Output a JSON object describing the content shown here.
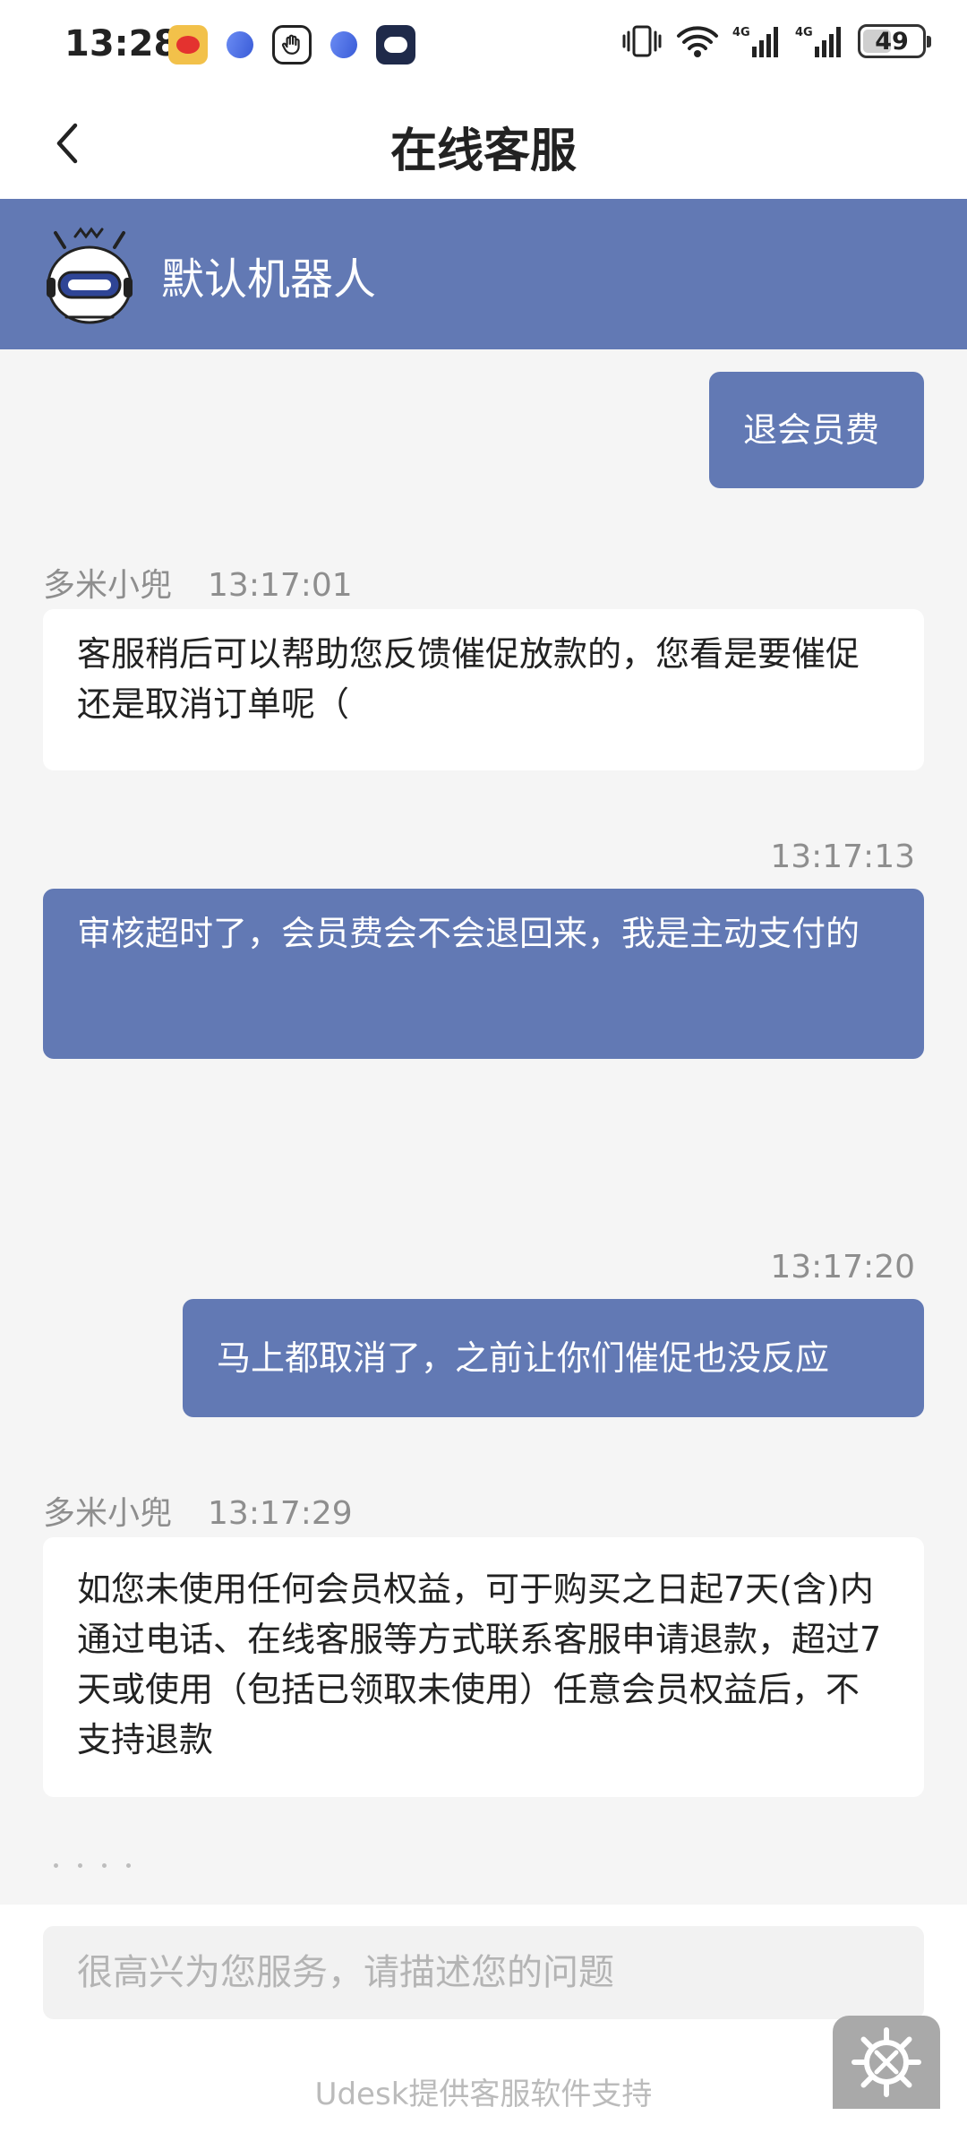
{
  "status_bar": {
    "time": "13:28",
    "battery": "49",
    "battery_level": 0.49,
    "network_labels": [
      "4G",
      "4G"
    ]
  },
  "nav": {
    "title": "在线客服"
  },
  "agent": {
    "name": "默认机器人"
  },
  "messages": [
    {
      "direction": "out",
      "text": "退会员费"
    },
    {
      "direction": "in",
      "sender": "多米小兜",
      "time": "13:17:01",
      "text": "客服稍后可以帮助您反馈催促放款的，您看是要催促还是取消订单呢（"
    },
    {
      "direction": "out",
      "time": "13:17:13",
      "text": "审核超时了，会员费会不会退回来，我是主动支付的"
    },
    {
      "direction": "out",
      "time": "13:17:20",
      "text": "马上都取消了，之前让你们催促也没反应"
    },
    {
      "direction": "in",
      "sender": "多米小兜",
      "time": "13:17:29",
      "text": "如您未使用任何会员权益，可于购买之日起7天(含)内通过电话、在线客服等方式联系客服申请退款，超过7天或使用（包括已领取未使用）任意会员权益后，不支持退款"
    }
  ],
  "input": {
    "placeholder": "很高兴为您服务，请描述您的问题"
  },
  "footer": {
    "note": "Udesk提供客服软件支持"
  },
  "colors": {
    "accent": "#6279b4",
    "chat_bg": "#f5f5f5"
  },
  "icons": [
    "weibo-icon",
    "blue-ball-icon",
    "hand-icon",
    "bot-app-icon",
    "vibrate-icon",
    "wifi-icon",
    "signal-icon",
    "battery-icon",
    "back-icon",
    "robot-avatar-icon",
    "settings-icon"
  ]
}
